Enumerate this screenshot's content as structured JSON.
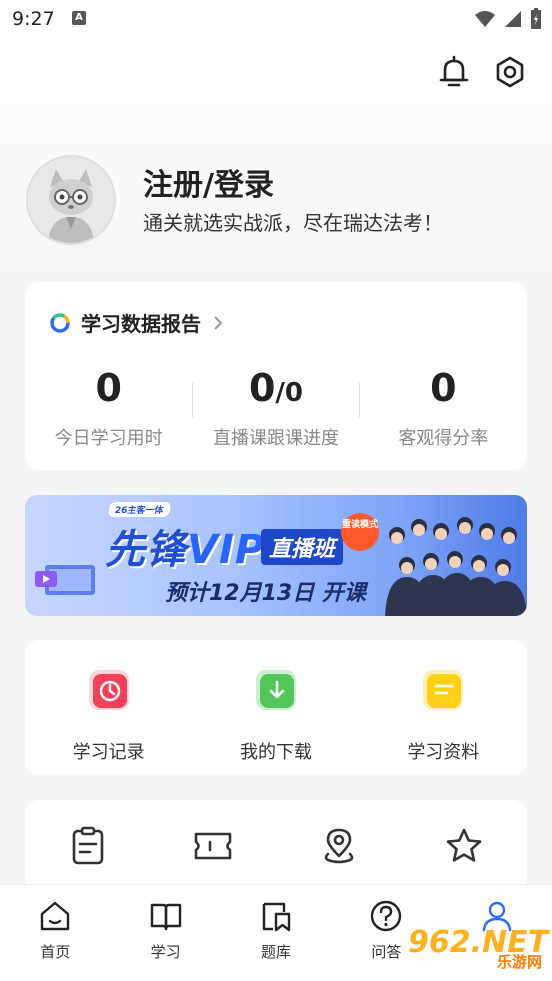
{
  "status_bar": {
    "time": "9:27",
    "a_icon": "A"
  },
  "header": {
    "icons": [
      "bell-icon",
      "settings-hex-icon"
    ]
  },
  "profile": {
    "title": "注册/登录",
    "subtitle": "通关就选实战派，尽在瑞达法考！"
  },
  "report": {
    "title": "学习数据报告",
    "stats": [
      {
        "value": "0",
        "label": "今日学习用时"
      },
      {
        "value": "0",
        "value_suffix": "/0",
        "label": "直播课跟课进度"
      },
      {
        "value": "0",
        "label": "客观得分率"
      }
    ]
  },
  "banner": {
    "tag": "26主客一体",
    "title_a": "先锋",
    "title_b": "VIP",
    "title_c": "直播班",
    "seal": "重读模式",
    "date": "预计12月13日 开课"
  },
  "tools": [
    {
      "label": "学习记录",
      "color": "#f0405a"
    },
    {
      "label": "我的下载",
      "color": "#52c65a"
    },
    {
      "label": "学习资料",
      "color": "#ffcf1a"
    }
  ],
  "more_icons": [
    "notes-icon",
    "ticket-icon",
    "location-icon",
    "star-icon"
  ],
  "bottom_nav": [
    {
      "label": "首页",
      "icon": "home-icon",
      "active": false
    },
    {
      "label": "学习",
      "icon": "book-icon",
      "active": false
    },
    {
      "label": "题库",
      "icon": "bookmark-icon",
      "active": false
    },
    {
      "label": "问答",
      "icon": "question-icon",
      "active": false
    },
    {
      "label": "",
      "icon": "user-icon",
      "active": true
    }
  ],
  "watermark": {
    "big": "962.NET",
    "small": "乐游网"
  },
  "colors": {
    "accent": "#2e68ff",
    "background": "#f5f5f7"
  }
}
